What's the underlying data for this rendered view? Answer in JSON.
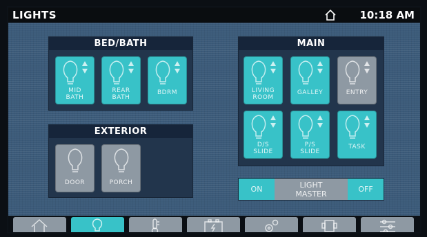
{
  "header": {
    "title": "LIGHTS",
    "time": "10:18 AM"
  },
  "panels": {
    "bedbath": {
      "title": "BED/BATH",
      "buttons": [
        {
          "label1": "MID",
          "label2": "BATH",
          "state": "on"
        },
        {
          "label1": "REAR",
          "label2": "BATH",
          "state": "on"
        },
        {
          "label1": "BDRM",
          "label2": "",
          "state": "on"
        }
      ]
    },
    "main": {
      "title": "MAIN",
      "buttons": [
        {
          "label1": "LIVING",
          "label2": "ROOM",
          "state": "on"
        },
        {
          "label1": "GALLEY",
          "label2": "",
          "state": "on"
        },
        {
          "label1": "ENTRY",
          "label2": "",
          "state": "off"
        },
        {
          "label1": "D/S",
          "label2": "SLIDE",
          "state": "on"
        },
        {
          "label1": "P/S",
          "label2": "SLIDE",
          "state": "on"
        },
        {
          "label1": "TASK",
          "label2": "",
          "state": "on"
        }
      ]
    },
    "exterior": {
      "title": "EXTERIOR",
      "buttons": [
        {
          "label1": "DOOR",
          "label2": "",
          "state": "off"
        },
        {
          "label1": "PORCH",
          "label2": "",
          "state": "off"
        }
      ]
    }
  },
  "master": {
    "on_label": "ON",
    "title_line1": "LIGHT",
    "title_line2": "MASTER",
    "off_label": "OFF"
  },
  "nav": {
    "active_tab": "lights",
    "tabs": [
      "home-icon",
      "lightbulb-icon",
      "thermometer-icon",
      "battery-icon",
      "gear-icon",
      "generator-icon",
      "sliders-icon"
    ]
  },
  "colors": {
    "on": "#38c2c8",
    "off": "#8e99a3",
    "panel": "#22354c",
    "background": "#3b5a79",
    "header": "#0a0d10"
  }
}
